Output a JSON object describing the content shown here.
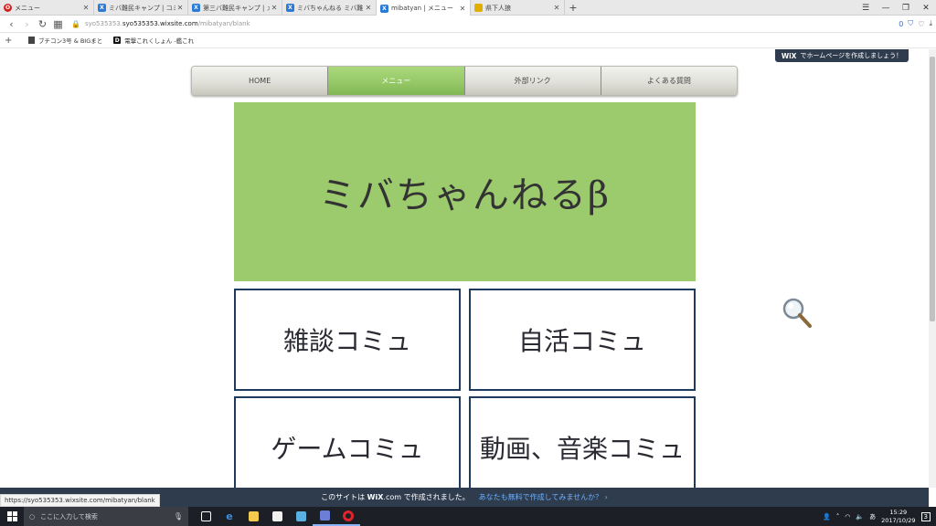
{
  "browser": {
    "tabs": [
      {
        "label": "メニュー",
        "icon": "opera-icon",
        "color": "#d32020",
        "active": false
      },
      {
        "label": "ミバ難民キャンプ | コミュニティ",
        "icon": "wix-icon",
        "color": "#2b7bd6",
        "active": false
      },
      {
        "label": "第三バ難民キャンプ | メニュー",
        "icon": "wix-icon",
        "color": "#2b7bd6",
        "active": false
      },
      {
        "label": "ミバちゃんねる ミバ難民キャン",
        "icon": "wix-icon",
        "color": "#2b7bd6",
        "active": false
      },
      {
        "label": "mibatyan | メニュー",
        "icon": "wix-icon",
        "color": "#2b7bd6",
        "active": true
      },
      {
        "label": "県下人狼",
        "icon": "wolf-icon",
        "color": "#e0b000",
        "active": false
      }
    ],
    "url_host": "syo535353.wixsite.com",
    "url_path": "/mibatyan/blank",
    "url_prefix": "syo535353.",
    "addr_badge": "0",
    "bookmarks": [
      {
        "label": "ブチコン3号 & BIGまと",
        "icon": "page-icon"
      },
      {
        "label": "電撃これくしょん -艦これ",
        "icon": "d-icon"
      }
    ],
    "status_url": "https://syo535353.wixsite.com/mibatyan/blank"
  },
  "page": {
    "wix_badge": {
      "logo": "WiX",
      "text": "でホームページを作成しましょう！"
    },
    "menu": [
      {
        "label": "HOME",
        "active": false
      },
      {
        "label": "メニュー",
        "active": true
      },
      {
        "label": "外部リンク",
        "active": false
      },
      {
        "label": "よくある質問",
        "active": false
      }
    ],
    "hero_title": "ミバちゃんねるβ",
    "cards": [
      {
        "label": "雑談コミュ"
      },
      {
        "label": "自活コミュ"
      },
      {
        "label": "ゲームコミュ"
      },
      {
        "label": "動画、音楽コミュ"
      }
    ],
    "footer": {
      "prefix": "このサイトは",
      "logo": "WiX",
      "logo_suffix": ".com",
      "suffix": "で作成されました。",
      "link": "あなたも無料で作成してみませんか？ ›"
    }
  },
  "taskbar": {
    "search_placeholder": "ここに入力して検索",
    "time": "15:29",
    "date": "2017/10/29",
    "notification_count": "3"
  },
  "colors": {
    "hero": "#9ccb6e",
    "menu_active": "#96c968",
    "card_border": "#1f3a5f",
    "wix_bar": "#2f3c4e"
  }
}
